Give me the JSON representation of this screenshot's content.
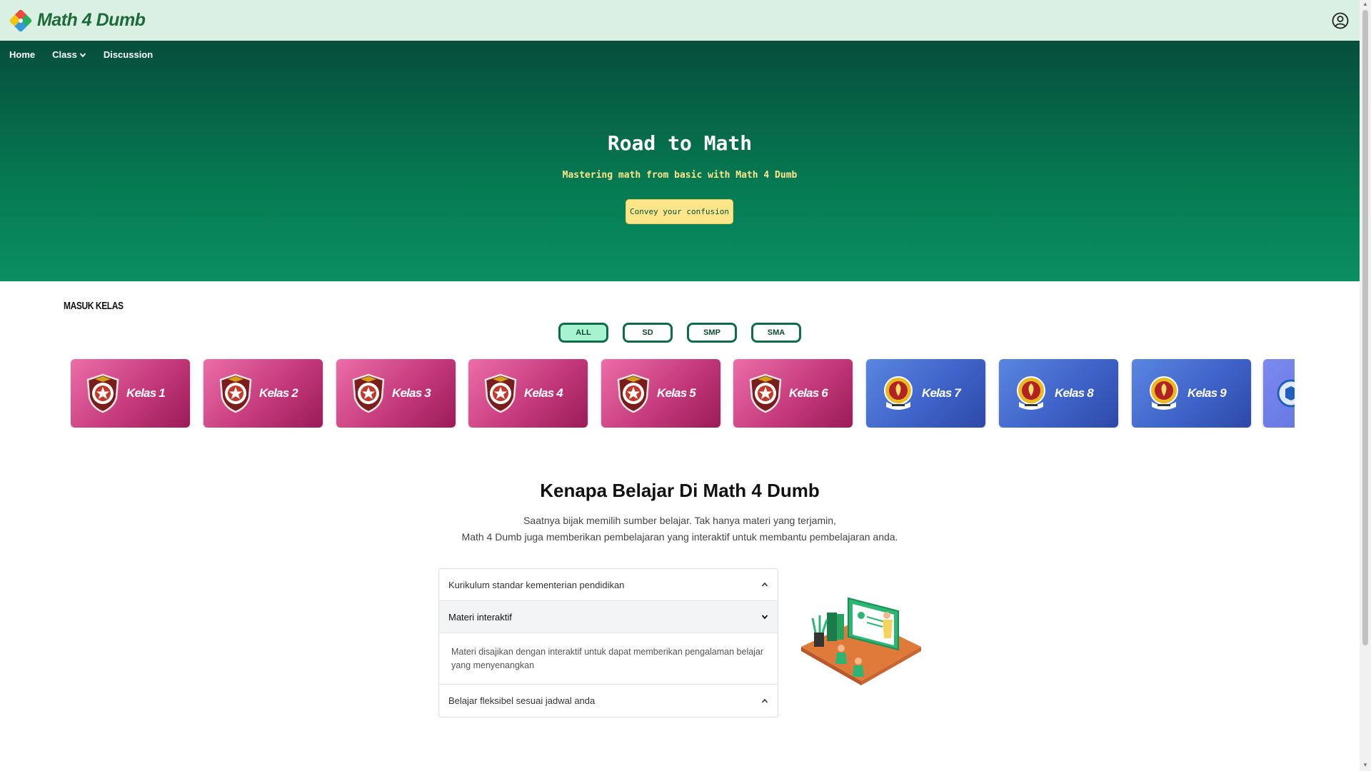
{
  "app": {
    "name": "Math 4 Dumb"
  },
  "nav": {
    "home": "Home",
    "class": "Class",
    "discussion": "Discussion"
  },
  "hero": {
    "title": "Road to Math",
    "subtitle": "Mastering math from basic with Math 4 Dumb",
    "cta": "Convey your confusion"
  },
  "classes": {
    "heading": "MASUK KELAS",
    "filters": [
      "ALL",
      "SD",
      "SMP",
      "SMA"
    ],
    "active_filter": "ALL",
    "cards": [
      "Kelas 1",
      "Kelas 2",
      "Kelas 3",
      "Kelas 4",
      "Kelas 5",
      "Kelas 6",
      "Kelas 7",
      "Kelas 8",
      "Kelas 9"
    ]
  },
  "why": {
    "title": "Kenapa Belajar Di Math 4 Dumb",
    "line1": "Saatnya bijak memilih sumber belajar. Tak hanya materi yang terjamin,",
    "line2": "Math 4 Dumb juga memberikan pembelajaran yang interaktif untuk membantu pembelajaran anda."
  },
  "accordion": {
    "items": [
      {
        "title": "Kurikulum standar kementerian pendidikan"
      },
      {
        "title": "Materi interaktif",
        "body": "Materi disajikan dengan interaktif untuk dapat memberikan pengalaman belajar yang menyenangkan"
      },
      {
        "title": "Belajar fleksibel sesuai jadwal anda"
      }
    ]
  },
  "colors": {
    "brand": "#1d6b3a",
    "hero_top": "#064e3b",
    "hero_bottom": "#0a8f62",
    "accent_yellow": "#fde68a",
    "card_sd": "#c53a7c",
    "card_smp": "#3f63c9"
  },
  "icons": {
    "logo": "diamond-logo-icon",
    "account": "user-circle-icon",
    "chevron": "chevron-down-icon"
  }
}
